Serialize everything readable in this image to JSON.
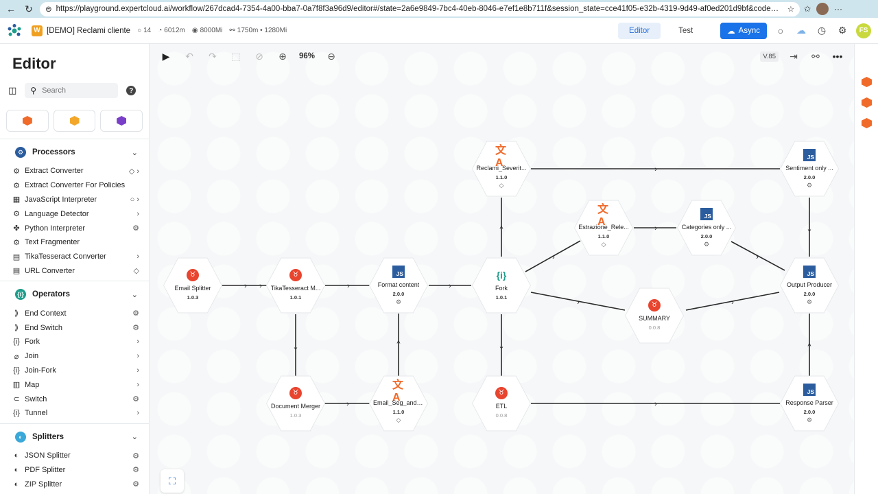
{
  "browser": {
    "url": "https://playground.expertcloud.ai/workflow/267dcad4-7354-4a00-bba7-0a7f8f3a96d9/editor#/state=2a6e9849-7bc4-40eb-8046-e7ef1e8b711f&session_state=cce41f05-e32b-4319-9d49-af0ed201d9bf&code=7272dc8a-734e-44..."
  },
  "appbar": {
    "workspace_badge": "W",
    "workspace_name": "[DEMO] Reclami cliente",
    "stats": [
      {
        "icon": "circle-icon",
        "value": "14"
      },
      {
        "icon": "gauge-icon",
        "value": "6012m"
      },
      {
        "icon": "chip-icon",
        "value": "8000Mi"
      },
      {
        "icon": "nodes-icon",
        "value": "1750m • 1280Mi"
      }
    ],
    "mode_editor": "Editor",
    "mode_test": "Test",
    "async_label": "Async",
    "user_initials": "FS"
  },
  "sidebar": {
    "title": "Editor",
    "search_placeholder": "Search",
    "help": "?",
    "sections": [
      {
        "label": "Processors",
        "color": "#2b5c9e",
        "icon_text": "⚙",
        "items": [
          {
            "label": "Extract Converter",
            "icon": "⚙",
            "right": "◇ ›"
          },
          {
            "label": "Extract Converter For Policies",
            "icon": "⚙",
            "right": ""
          },
          {
            "label": "JavaScript Interpreter",
            "icon": "▦",
            "right": "○ ›"
          },
          {
            "label": "Language Detector",
            "icon": "⚙",
            "right": "›"
          },
          {
            "label": "Python Interpreter",
            "icon": "✤",
            "right": "⚙"
          },
          {
            "label": "Text Fragmenter",
            "icon": "⚙",
            "right": ""
          },
          {
            "label": "TikaTesseract Converter",
            "icon": "▤",
            "right": "›"
          },
          {
            "label": "URL Converter",
            "icon": "▤",
            "right": "◇"
          }
        ]
      },
      {
        "label": "Operators",
        "color": "#1e9d8b",
        "icon_text": "{i}",
        "items": [
          {
            "label": "End Context",
            "icon": "⟫",
            "right": "⚙"
          },
          {
            "label": "End Switch",
            "icon": "⟫",
            "right": "⚙"
          },
          {
            "label": "Fork",
            "icon": "{i}",
            "right": "›"
          },
          {
            "label": "Join",
            "icon": "⌀",
            "right": "›"
          },
          {
            "label": "Join-Fork",
            "icon": "{i}",
            "right": "›"
          },
          {
            "label": "Map",
            "icon": "▥",
            "right": "›"
          },
          {
            "label": "Switch",
            "icon": "⊂",
            "right": "⚙"
          },
          {
            "label": "Tunnel",
            "icon": "{i}",
            "right": "›"
          }
        ]
      },
      {
        "label": "Splitters",
        "color": "#3aa8d8",
        "icon_text": "◐",
        "items": [
          {
            "label": "JSON Splitter",
            "icon": "◐",
            "right": "⚙"
          },
          {
            "label": "PDF Splitter",
            "icon": "◐",
            "right": "⚙"
          },
          {
            "label": "ZIP Splitter",
            "icon": "◐",
            "right": "⚙"
          }
        ]
      }
    ]
  },
  "toolbar": {
    "zoom": "96%",
    "version": "V.85"
  },
  "colors": {
    "accent": "#1a73e8",
    "translate": "#f06a2a",
    "js": "#2b5c9e",
    "brand_red": "#e8442e",
    "fork": "#1e9d8b"
  },
  "nodes": [
    {
      "id": "email_splitter",
      "name": "Email Splitter",
      "version": "1.0.3",
      "icon": "br",
      "mark": ""
    },
    {
      "id": "tika",
      "name": "TikaTesseract M...",
      "version": "1.0.1",
      "icon": "br",
      "mark": ""
    },
    {
      "id": "format",
      "name": "Format content",
      "version": "2.0.0",
      "icon": "js",
      "mark": "⚙"
    },
    {
      "id": "fork",
      "name": "Fork",
      "version": "1.0.1",
      "icon": "fk",
      "mark": ""
    },
    {
      "id": "reclami",
      "name": "Reclami_Severit...",
      "version": "1.1.0",
      "icon": "tr",
      "mark": "◇"
    },
    {
      "id": "estrazione",
      "name": "Estrazione_Rele...",
      "version": "1.1.0",
      "icon": "tr",
      "mark": "◇"
    },
    {
      "id": "categories",
      "name": "Categories only ...",
      "version": "2.0.0",
      "icon": "js",
      "mark": "⚙"
    },
    {
      "id": "sentiment",
      "name": "Sentiment only ...",
      "version": "2.0.0",
      "icon": "js",
      "mark": "⚙"
    },
    {
      "id": "output",
      "name": "Output Producer",
      "version": "2.0.0",
      "icon": "js",
      "mark": "⚙"
    },
    {
      "id": "summary",
      "name": "SUMMARY",
      "version": "0.0.8",
      "icon": "br",
      "mark": "",
      "grey": true
    },
    {
      "id": "docmerger",
      "name": "Document Merger",
      "version": "1.0.3",
      "icon": "br",
      "mark": "",
      "grey": true
    },
    {
      "id": "emailseg",
      "name": "Email_Seg_and-...",
      "version": "1.1.0",
      "icon": "tr",
      "mark": "◇"
    },
    {
      "id": "etl",
      "name": "ETL",
      "version": "0.0.8",
      "icon": "br",
      "mark": "",
      "grey": true
    },
    {
      "id": "response",
      "name": "Response Parser",
      "version": "2.0.0",
      "icon": "js",
      "mark": "⚙"
    }
  ]
}
